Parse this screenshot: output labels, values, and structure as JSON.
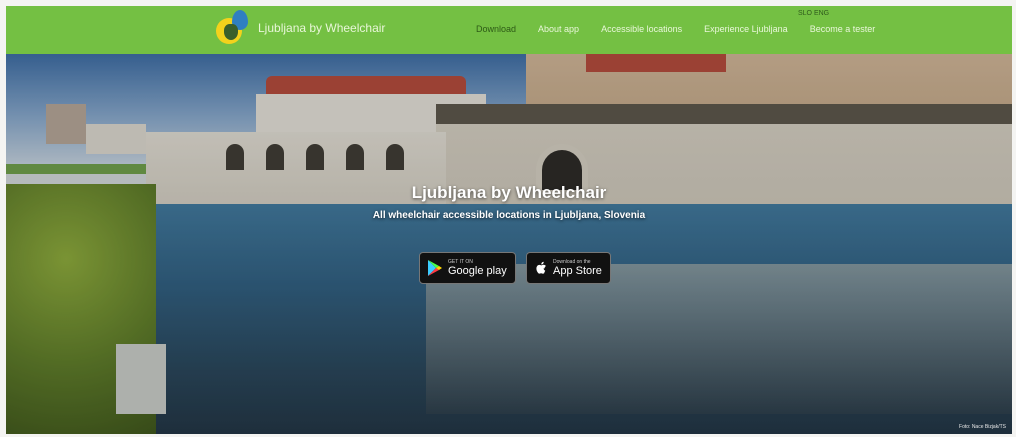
{
  "navbar": {
    "brand": "Ljubljana by Wheelchair",
    "links": [
      "Download",
      "About app",
      "Accessible locations",
      "Experience Ljubljana",
      "Become a tester"
    ],
    "lang": "SLO ENG"
  },
  "hero": {
    "title": "Ljubljana by Wheelchair",
    "subtitle": "All wheelchair accessible locations in Ljubljana, Slovenia",
    "google_play": {
      "small": "GET IT ON",
      "big": "Google play"
    },
    "app_store": {
      "small": "Download on the",
      "big": "App Store"
    },
    "credit": "Foto: Nace Bizjak/TS"
  },
  "colors": {
    "nav": "#74c043",
    "nav_active": "#2d5a16"
  },
  "icons": [
    "app-logo-icon",
    "google-play-icon",
    "apple-icon"
  ]
}
